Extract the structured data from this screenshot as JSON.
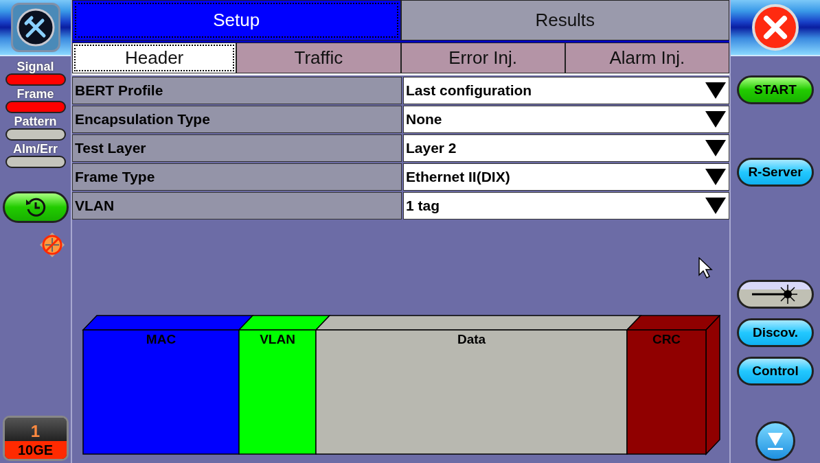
{
  "status_indicators": [
    {
      "label": "Signal",
      "color": "#ff0000"
    },
    {
      "label": "Frame",
      "color": "#ff0000"
    },
    {
      "label": "Pattern",
      "color": "#c4c4bc"
    },
    {
      "label": "Alm/Err",
      "color": "#c4c4bc"
    }
  ],
  "port": {
    "number": "1",
    "rate": "10GE"
  },
  "tabs": [
    {
      "label": "Setup",
      "selected": true
    },
    {
      "label": "Results",
      "selected": false
    }
  ],
  "subtabs": [
    {
      "label": "Header",
      "selected": true
    },
    {
      "label": "Traffic",
      "selected": false
    },
    {
      "label": "Error Inj.",
      "selected": false
    },
    {
      "label": "Alarm Inj.",
      "selected": false
    }
  ],
  "settings": [
    {
      "label": "BERT Profile",
      "value": "Last configuration"
    },
    {
      "label": "Encapsulation Type",
      "value": "None"
    },
    {
      "label": "Test Layer",
      "value": "Layer 2"
    },
    {
      "label": "Frame Type",
      "value": "Ethernet II(DIX)"
    },
    {
      "label": "VLAN",
      "value": "1 tag"
    }
  ],
  "frame_segments": [
    {
      "label": "MAC",
      "color": "#0000ff"
    },
    {
      "label": "VLAN",
      "color": "#00ff00"
    },
    {
      "label": "Data",
      "color": "#b8b8b0"
    },
    {
      "label": "CRC",
      "color": "#900000"
    }
  ],
  "right_buttons": [
    {
      "kind": "start",
      "label": "START"
    },
    {
      "kind": "blue",
      "label": "R-Server"
    },
    {
      "kind": "laser"
    },
    {
      "kind": "blue",
      "label": "Discov."
    },
    {
      "kind": "blue",
      "label": "Control"
    }
  ]
}
